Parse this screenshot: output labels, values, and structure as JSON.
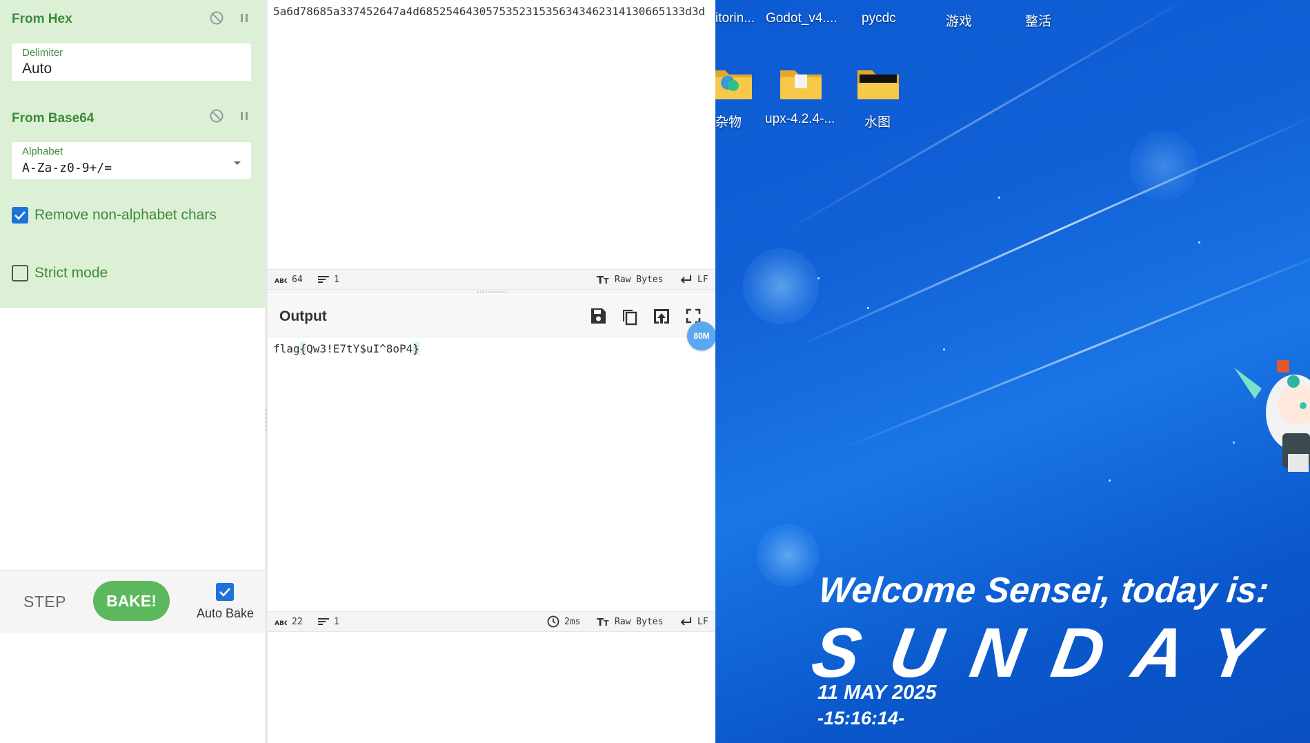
{
  "recipe": {
    "operations": [
      {
        "title": "From Hex",
        "field_label": "Delimiter",
        "field_value": "Auto"
      },
      {
        "title": "From Base64",
        "field_label": "Alphabet",
        "field_value": "A-Za-z0-9+/=",
        "checkbox_remove_label": "Remove non-alphabet chars",
        "checkbox_remove_checked": true,
        "checkbox_strict_label": "Strict mode",
        "checkbox_strict_checked": false
      }
    ],
    "controls": {
      "step_label": "STEP",
      "bake_label": "BAKE!",
      "autobake_label": "Auto Bake",
      "autobake_checked": true
    }
  },
  "input": {
    "text": "5a6d78685a337452647a4d6852546430575352315356343462314130665133d3d",
    "status": {
      "length": "64",
      "lines": "1",
      "encoding": "Raw Bytes",
      "eol": "LF"
    }
  },
  "output": {
    "title": "Output",
    "text_prefix": "flag",
    "text_open": "{",
    "text_body": "Qw3!E7tY$uI^8oP4",
    "text_close": "}",
    "size_badge": "80M",
    "status": {
      "length": "22",
      "lines": "1",
      "time": "2ms",
      "encoding": "Raw Bytes",
      "eol": "LF"
    }
  },
  "desktop": {
    "icons": [
      {
        "label": "itorin..."
      },
      {
        "label": "Godot_v4...."
      },
      {
        "label": "pycdc"
      },
      {
        "label": "游戏"
      },
      {
        "label": "整活"
      },
      {
        "label": "杂物"
      },
      {
        "label": "upx-4.2.4-..."
      },
      {
        "label": "水图"
      }
    ],
    "wallpaper": {
      "welcome": "Welcome Sensei, today is:",
      "day": "SUNDAY",
      "date": "11 MAY 2025",
      "time": "-15:16:14-"
    }
  },
  "colors": {
    "recipe_bg": "#dcf0d5",
    "recipe_text": "#3c8a3c",
    "bake_button": "#5cb85c",
    "checkbox_blue": "#1e73d8",
    "size_badge": "#5aa9f0",
    "desktop_blue": "#1160d6",
    "folder_yellow": "#f7c948"
  },
  "icons": {
    "disable": "disable-icon",
    "pause": "pause-icon",
    "dropdown": "chevron-down-icon",
    "save": "save-icon",
    "copy": "copy-icon",
    "replace_input": "replace-input-icon",
    "maximise": "maximise-icon",
    "length": "abc-length-icon",
    "lines": "lines-icon",
    "encoding": "font-size-icon",
    "eol": "return-icon",
    "time": "clock-icon"
  }
}
